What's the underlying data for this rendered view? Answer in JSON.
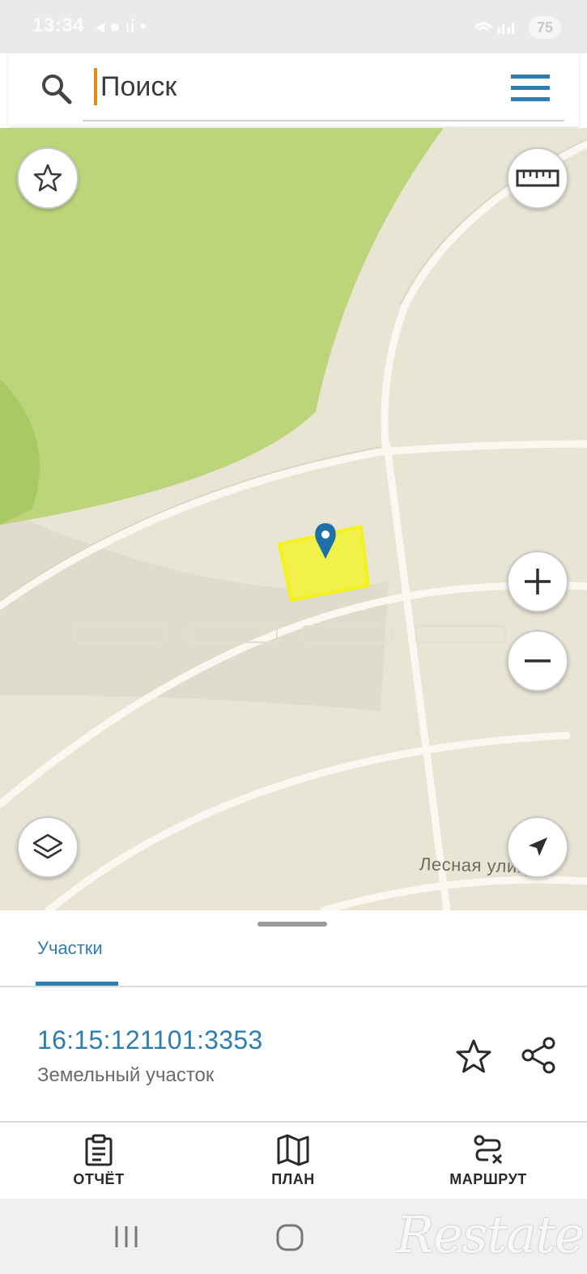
{
  "status_bar": {
    "time": "13:34",
    "notification_icons": "◂ ● ıⅰ •",
    "battery": "75"
  },
  "search": {
    "placeholder": "Поиск"
  },
  "map": {
    "street_label": "Лесная улица",
    "buttons": [
      "favorites-icon",
      "ruler-icon",
      "zoom-in-icon",
      "zoom-out-icon",
      "layers-icon",
      "my-location-icon"
    ],
    "colors": {
      "forest": "#bbd47a",
      "ground": "#e9e5d5",
      "road": "#faf8f1",
      "parcel": "#f2f24a",
      "marker": "#1f6fa8"
    }
  },
  "sheet": {
    "tab_label": "Участки",
    "parcel_id": "16:15:121101:3353",
    "parcel_type": "Земельный участок"
  },
  "bottom_nav": {
    "items": [
      {
        "label": "ОТЧЁТ",
        "icon": "clipboard-icon"
      },
      {
        "label": "ПЛАН",
        "icon": "map-icon"
      },
      {
        "label": "МАРШРУТ",
        "icon": "route-icon"
      }
    ]
  },
  "watermark": "Restate",
  "accent_color": "#2f7eb0"
}
